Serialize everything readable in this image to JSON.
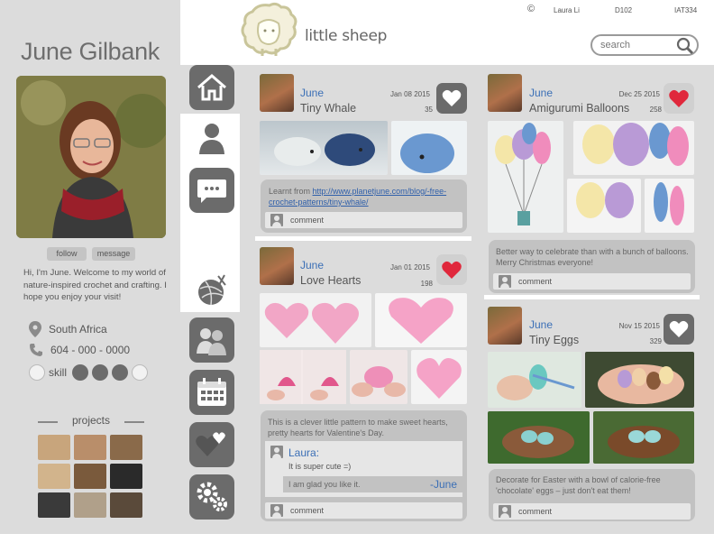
{
  "profile": {
    "name": "June Gilbank",
    "follow_label": "follow",
    "message_label": "message",
    "bio": "Hi, I'm June. Welcome to my world of nature-inspired crochet and crafting. I hope you enjoy your visit!",
    "location": "South Africa",
    "phone": "604 - 000 - 0000",
    "skill_label": "skill",
    "skill_level": 3,
    "skill_max": 4,
    "projects_label": "projects",
    "project_thumb_colors": [
      "#c8a57c",
      "#b98e6a",
      "#8a6a4a",
      "#d2b48c",
      "#7a5a3c",
      "#2a2a2a",
      "#3a3a3a",
      "#b0a08a",
      "#5a4a3a"
    ]
  },
  "header": {
    "brand": "little sheep",
    "copyright_symbol": "©",
    "author": "Laura Li",
    "room": "D102",
    "course": "IAT334",
    "search_placeholder": "search"
  },
  "nav": {
    "items": [
      {
        "name": "home",
        "icon": "home-icon"
      },
      {
        "name": "profile",
        "icon": "person-icon",
        "active": true
      },
      {
        "name": "messages",
        "icon": "chat-bubble-icon"
      },
      {
        "name": "yarn",
        "icon": "yarn-ball-icon",
        "active": true
      },
      {
        "name": "friends",
        "icon": "people-icon"
      },
      {
        "name": "calendar",
        "icon": "calendar-icon"
      },
      {
        "name": "favorites",
        "icon": "hearts-icon"
      },
      {
        "name": "settings",
        "icon": "gears-icon"
      }
    ]
  },
  "posts": [
    {
      "user": "June",
      "title": "Tiny Whale",
      "date": "Jan 08 2015",
      "count": "35",
      "liked": false,
      "description_prefix": "Learnt from ",
      "description_link": "http://www.planetjune.com/blog/-free-crochet-patterns/tiny-whale/",
      "comment_label": "comment"
    },
    {
      "user": "June",
      "title": "Love Hearts",
      "date": "Jan 01 2015",
      "count": "198",
      "liked": true,
      "description": "This is a clever little pattern to make sweet hearts, pretty hearts for Valentine's Day.",
      "reply_name": "Laura:",
      "reply_text": "It is super cute =)",
      "reply2_text": "I am glad you like it.",
      "reply2_sig": "-June",
      "comment_label": "comment"
    },
    {
      "user": "June",
      "title": "Amigurumi Balloons",
      "date": "Dec 25 2015",
      "count": "258",
      "liked": true,
      "description": "Better way to celebrate than with a bunch of balloons. Merry Christmas everyone!",
      "comment_label": "comment"
    },
    {
      "user": "June",
      "title": "Tiny Eggs",
      "date": "Nov 15 2015",
      "count": "329",
      "liked": false,
      "description": "Decorate for Easter with a bowl of calorie-free 'chocolate' eggs – just don't eat them!",
      "comment_label": "comment"
    }
  ],
  "colors": {
    "accent_blue": "#3b6fb6",
    "heart_red": "#e0283c",
    "panel_gray": "#dcdcdc",
    "icon_gray": "#6b6b6b"
  }
}
